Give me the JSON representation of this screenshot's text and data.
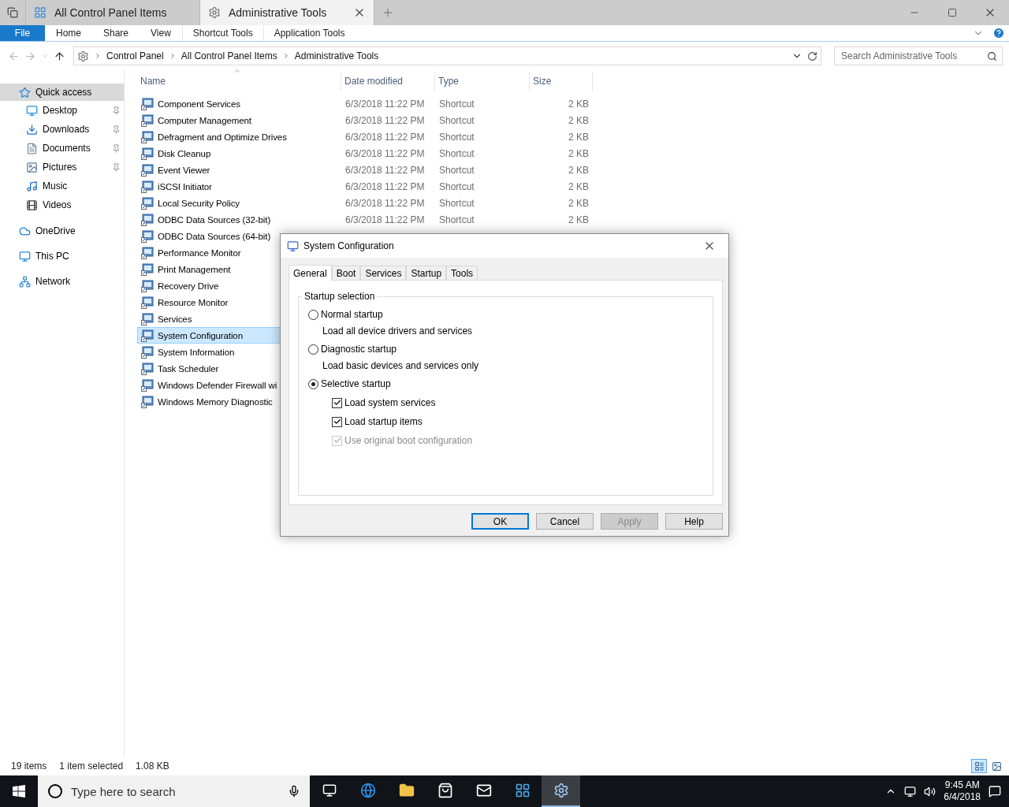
{
  "window": {
    "tabs": [
      {
        "label": "All Control Panel Items",
        "selected": false
      },
      {
        "label": "Administrative Tools",
        "selected": true
      }
    ]
  },
  "ribbon": {
    "file": "File",
    "tabs": [
      "Home",
      "Share",
      "View",
      "Shortcut Tools",
      "Application Tools"
    ]
  },
  "address": {
    "breadcrumb": [
      "Control Panel",
      "All Control Panel Items",
      "Administrative Tools"
    ],
    "search_placeholder": "Search Administrative Tools"
  },
  "sidebar": {
    "items": [
      {
        "label": "Quick access",
        "selected": true,
        "children": [
          {
            "label": "Desktop",
            "pinned": true
          },
          {
            "label": "Downloads",
            "pinned": true
          },
          {
            "label": "Documents",
            "pinned": true
          },
          {
            "label": "Pictures",
            "pinned": true
          },
          {
            "label": "Music",
            "pinned": false
          },
          {
            "label": "Videos",
            "pinned": false
          }
        ]
      },
      {
        "label": "OneDrive",
        "selected": false
      },
      {
        "label": "This PC",
        "selected": false
      },
      {
        "label": "Network",
        "selected": false
      }
    ]
  },
  "table": {
    "columns": [
      {
        "label": "Name"
      },
      {
        "label": "Date modified"
      },
      {
        "label": "Type"
      },
      {
        "label": "Size"
      }
    ],
    "rows": [
      {
        "name": "Component Services",
        "date": "6/3/2018 11:22 PM",
        "type": "Shortcut",
        "size": "2 KB",
        "selected": false
      },
      {
        "name": "Computer Management",
        "date": "6/3/2018 11:22 PM",
        "type": "Shortcut",
        "size": "2 KB",
        "selected": false
      },
      {
        "name": "Defragment and Optimize Drives",
        "date": "6/3/2018 11:22 PM",
        "type": "Shortcut",
        "size": "2 KB",
        "selected": false
      },
      {
        "name": "Disk Cleanup",
        "date": "6/3/2018 11:22 PM",
        "type": "Shortcut",
        "size": "2 KB",
        "selected": false
      },
      {
        "name": "Event Viewer",
        "date": "6/3/2018 11:22 PM",
        "type": "Shortcut",
        "size": "2 KB",
        "selected": false
      },
      {
        "name": "iSCSI Initiator",
        "date": "6/3/2018 11:22 PM",
        "type": "Shortcut",
        "size": "2 KB",
        "selected": false
      },
      {
        "name": "Local Security Policy",
        "date": "6/3/2018 11:22 PM",
        "type": "Shortcut",
        "size": "2 KB",
        "selected": false
      },
      {
        "name": "ODBC Data Sources (32-bit)",
        "date": "6/3/2018 11:22 PM",
        "type": "Shortcut",
        "size": "2 KB",
        "selected": false
      },
      {
        "name": "ODBC Data Sources (64-bit)",
        "selected": false
      },
      {
        "name": "Performance Monitor",
        "selected": false
      },
      {
        "name": "Print Management",
        "selected": false
      },
      {
        "name": "Recovery Drive",
        "selected": false
      },
      {
        "name": "Resource Monitor",
        "selected": false
      },
      {
        "name": "Services",
        "selected": false
      },
      {
        "name": "System Configuration",
        "selected": true
      },
      {
        "name": "System Information",
        "selected": false
      },
      {
        "name": "Task Scheduler",
        "selected": false
      },
      {
        "name": "Windows Defender Firewall wi",
        "selected": false
      },
      {
        "name": "Windows Memory Diagnostic",
        "selected": false
      }
    ]
  },
  "status_bar": {
    "count": "19 items",
    "selection": "1 item selected",
    "size": "1.08 KB",
    "views": [
      {
        "selected": true
      },
      {
        "selected": false
      }
    ]
  },
  "dialog": {
    "title": "System Configuration",
    "tabs": [
      {
        "label": "General",
        "selected": true
      },
      {
        "label": "Boot",
        "selected": false
      },
      {
        "label": "Services",
        "selected": false
      },
      {
        "label": "Startup",
        "selected": false
      },
      {
        "label": "Tools",
        "selected": false
      }
    ],
    "group": "Startup selection",
    "options": [
      {
        "label": "Normal startup",
        "description": "Load all device drivers and services",
        "selected": false
      },
      {
        "label": "Diagnostic startup",
        "description": "Load basic devices and services only",
        "selected": false
      },
      {
        "label": "Selective startup",
        "selected": true
      }
    ],
    "checks": [
      {
        "label": "Load system services",
        "checked": true,
        "disabled": false
      },
      {
        "label": "Load startup items",
        "checked": true,
        "disabled": false
      },
      {
        "label": "Use original boot configuration",
        "checked": true,
        "disabled": true
      }
    ],
    "buttons": [
      {
        "label": "OK",
        "kind": "default",
        "disabled": false
      },
      {
        "label": "Cancel",
        "kind": "normal",
        "disabled": false
      },
      {
        "label": "Apply",
        "kind": "normal",
        "disabled": true
      },
      {
        "label": "Help",
        "kind": "normal",
        "disabled": false
      }
    ]
  },
  "taskbar": {
    "search_placeholder": "Type here to search",
    "apps": [
      {
        "selected": false
      },
      {
        "selected": false
      },
      {
        "selected": false
      },
      {
        "selected": false
      },
      {
        "selected": false
      },
      {
        "selected": false
      },
      {
        "selected": true
      }
    ],
    "time": "9:45 AM",
    "date": "6/4/2018"
  }
}
